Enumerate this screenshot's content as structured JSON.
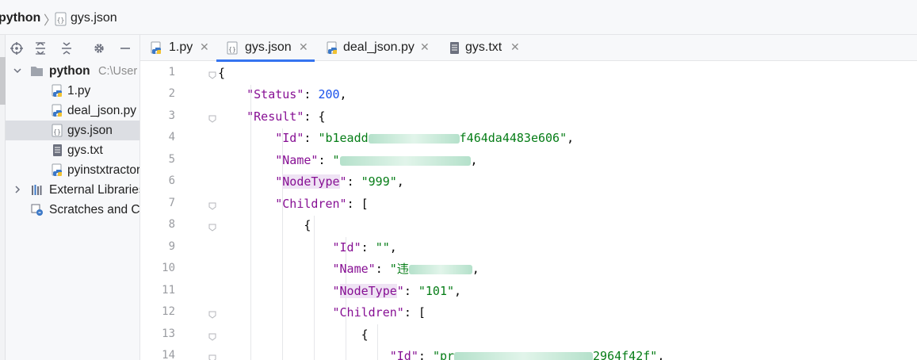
{
  "breadcrumb": {
    "project": "python",
    "file": "gys.json"
  },
  "project_panel": {
    "toolbar_icons": [
      "locate-icon",
      "expand-all-icon",
      "collapse-all-icon",
      "gear-icon",
      "minimize-icon"
    ],
    "root": {
      "name": "python",
      "path_hint": "C:\\User"
    },
    "files": [
      {
        "name": "1.py",
        "icon": "python-file-icon"
      },
      {
        "name": "deal_json.py",
        "icon": "python-file-icon"
      },
      {
        "name": "gys.json",
        "icon": "json-file-icon",
        "selected": true
      },
      {
        "name": "gys.txt",
        "icon": "text-file-icon"
      },
      {
        "name": "pyinstxtractor",
        "icon": "python-file-icon"
      }
    ],
    "external_libraries": "External Libraries",
    "scratches": "Scratches and Consoles"
  },
  "tabs": [
    {
      "label": "1.py",
      "icon": "python-file-icon",
      "active": false
    },
    {
      "label": "gys.json",
      "icon": "json-file-icon",
      "active": true
    },
    {
      "label": "deal_json.py",
      "icon": "python-file-icon",
      "active": false
    },
    {
      "label": "gys.txt",
      "icon": "text-file-icon",
      "active": false
    }
  ],
  "editor": {
    "line_numbers": [
      "1",
      "2",
      "3",
      "4",
      "5",
      "6",
      "7",
      "8",
      "9",
      "10",
      "11",
      "12",
      "13",
      "14"
    ],
    "code": {
      "l1_open": "{",
      "status_key": "\"Status\"",
      "status_value": "200",
      "result_key": "\"Result\"",
      "result_open": "{",
      "id_key": "\"Id\"",
      "id_value_start": "\"b1eadd",
      "id_value_end": "f464da4483e606\"",
      "name_key": "\"Name\"",
      "name_value_start": "\"",
      "nodetype_key_q1": "\"",
      "nodetype_key": "NodeType",
      "nodetype_key_q2": "\"",
      "nodetype_value": "\"999\"",
      "children_key": "\"Children\"",
      "children_open": "[",
      "child_open": "{",
      "child_id_key": "\"Id\"",
      "child_id_value": "\"\"",
      "child_name_key": "\"Name\"",
      "child_name_value_start": "\"",
      "child_name_partial": "违",
      "child_nodetype_value": "\"101\"",
      "grand_open": "{",
      "grand_id_value_start": "\"pr",
      "grand_id_value_end": "2964f42f\""
    }
  },
  "colors": {
    "keyword": "#871094",
    "string": "#067d17",
    "number": "#1750eb",
    "tab_active_underline": "#3574f0"
  }
}
